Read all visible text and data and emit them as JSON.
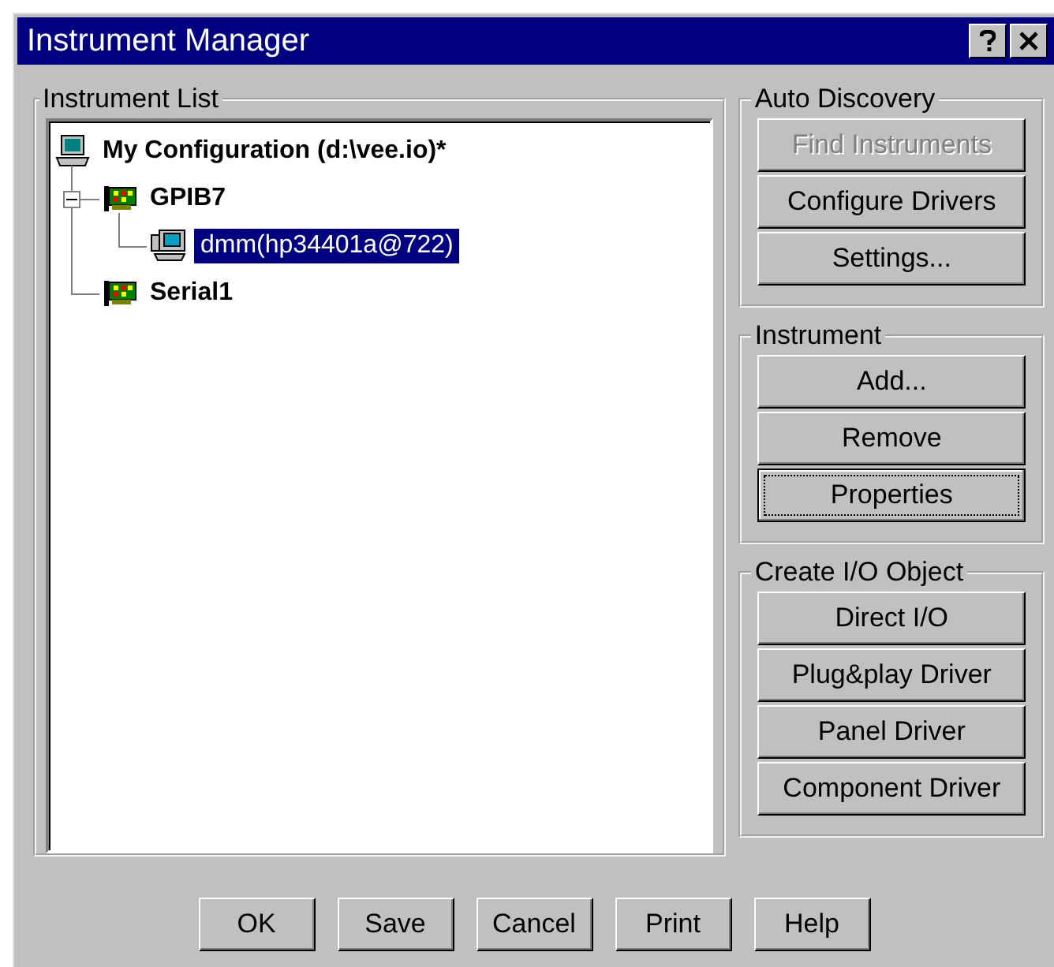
{
  "window": {
    "title": "Instrument Manager"
  },
  "instrument_list": {
    "title": "Instrument List",
    "tree": [
      {
        "label": "My Configuration (d:\\vee.io)*",
        "kind": "computer",
        "selected": false,
        "children": [
          {
            "label": "GPIB7",
            "kind": "card",
            "selected": false,
            "expanded": true,
            "children": [
              {
                "label": "dmm(hp34401a@722)",
                "kind": "instrument",
                "selected": true
              }
            ]
          },
          {
            "label": "Serial1",
            "kind": "card",
            "selected": false
          }
        ]
      }
    ]
  },
  "groups": [
    {
      "title": "Auto Discovery",
      "buttons": [
        {
          "label": "Find Instruments",
          "disabled": true,
          "focused": false
        },
        {
          "label": "Configure Drivers",
          "disabled": false,
          "focused": false
        },
        {
          "label": "Settings...",
          "disabled": false,
          "focused": false
        }
      ]
    },
    {
      "title": "Instrument",
      "buttons": [
        {
          "label": "Add...",
          "disabled": false,
          "focused": false
        },
        {
          "label": "Remove",
          "disabled": false,
          "focused": false
        },
        {
          "label": "Properties",
          "disabled": false,
          "focused": true
        }
      ]
    },
    {
      "title": "Create I/O Object",
      "buttons": [
        {
          "label": "Direct I/O",
          "disabled": false,
          "focused": false
        },
        {
          "label": "Plug&play Driver",
          "disabled": false,
          "focused": false
        },
        {
          "label": "Panel Driver",
          "disabled": false,
          "focused": false
        },
        {
          "label": "Component Driver",
          "disabled": false,
          "focused": false
        }
      ]
    }
  ],
  "footer_buttons": [
    "OK",
    "Save",
    "Cancel",
    "Print",
    "Help"
  ]
}
